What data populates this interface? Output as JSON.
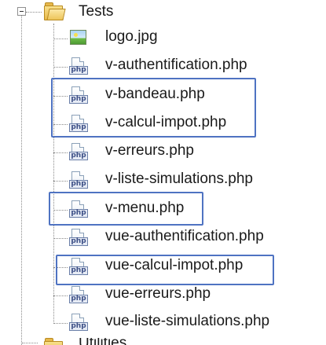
{
  "tree": {
    "folder": {
      "label": "Tests",
      "icon": "folder-open-icon",
      "expanded": true
    },
    "files": [
      {
        "label": "logo.jpg",
        "icon": "image-file-icon"
      },
      {
        "label": "v-authentification.php",
        "icon": "php-file-icon",
        "tag": "php"
      },
      {
        "label": "v-bandeau.php",
        "icon": "php-file-icon",
        "tag": "php"
      },
      {
        "label": "v-calcul-impot.php",
        "icon": "php-file-icon",
        "tag": "php"
      },
      {
        "label": "v-erreurs.php",
        "icon": "php-file-icon",
        "tag": "php"
      },
      {
        "label": "v-liste-simulations.php",
        "icon": "php-file-icon",
        "tag": "php"
      },
      {
        "label": "v-menu.php",
        "icon": "php-file-icon",
        "tag": "php"
      },
      {
        "label": "vue-authentification.php",
        "icon": "php-file-icon",
        "tag": "php"
      },
      {
        "label": "vue-calcul-impot.php",
        "icon": "php-file-icon",
        "tag": "php"
      },
      {
        "label": "vue-erreurs.php",
        "icon": "php-file-icon",
        "tag": "php"
      },
      {
        "label": "vue-liste-simulations.php",
        "icon": "php-file-icon",
        "tag": "php"
      }
    ],
    "next_folder": {
      "label": "Utilities",
      "icon": "folder-icon"
    }
  },
  "highlight_color": "#4f73c2"
}
